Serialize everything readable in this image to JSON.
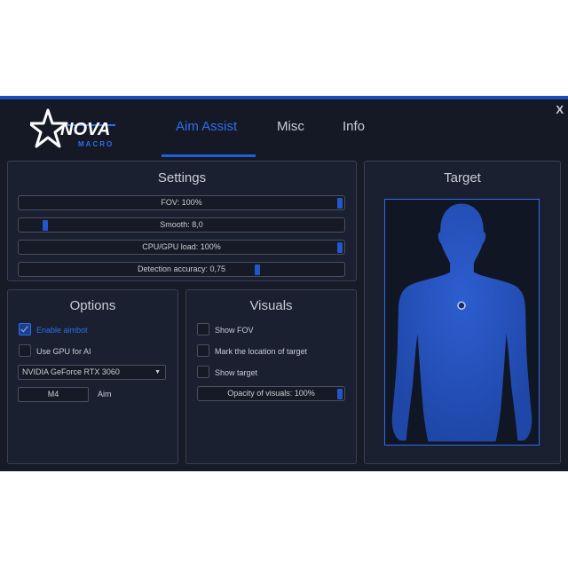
{
  "header": {
    "logo_text": "NOVA",
    "logo_sub": "MACRO",
    "tabs": [
      {
        "label": "Aim Assist"
      },
      {
        "label": "Misc"
      },
      {
        "label": "Info"
      }
    ],
    "close_label": "X"
  },
  "settings": {
    "title": "Settings",
    "sliders": [
      {
        "label": "FOV: 100%",
        "level": 1.0
      },
      {
        "label": "Smooth: 8,0",
        "level": 0.07
      },
      {
        "label": "CPU/GPU load: 100%",
        "level": 1.0
      },
      {
        "label": "Detection accuracy: 0,75",
        "level": 0.74
      }
    ]
  },
  "options": {
    "title": "Options",
    "enable_aimbot": {
      "label": "Enable aimbot",
      "checked": true
    },
    "use_gpu": {
      "label": "Use GPU for AI",
      "checked": false
    },
    "gpu_select": "NVIDIA GeForce RTX 3060",
    "key_value": "M4",
    "key_label": "Aim"
  },
  "visuals": {
    "title": "Visuals",
    "show_fov": {
      "label": "Show FOV",
      "checked": false
    },
    "mark_target": {
      "label": "Mark the location of target",
      "checked": false
    },
    "show_target": {
      "label": "Show target",
      "checked": false
    },
    "opacity_slider": {
      "label": "Opacity of visuals: 100%",
      "level": 1.0
    }
  },
  "target": {
    "title": "Target"
  },
  "colors": {
    "accent": "#2f6df0",
    "background": "#161b27",
    "panel": "#1b2030",
    "silhouette": "#2450b8"
  }
}
